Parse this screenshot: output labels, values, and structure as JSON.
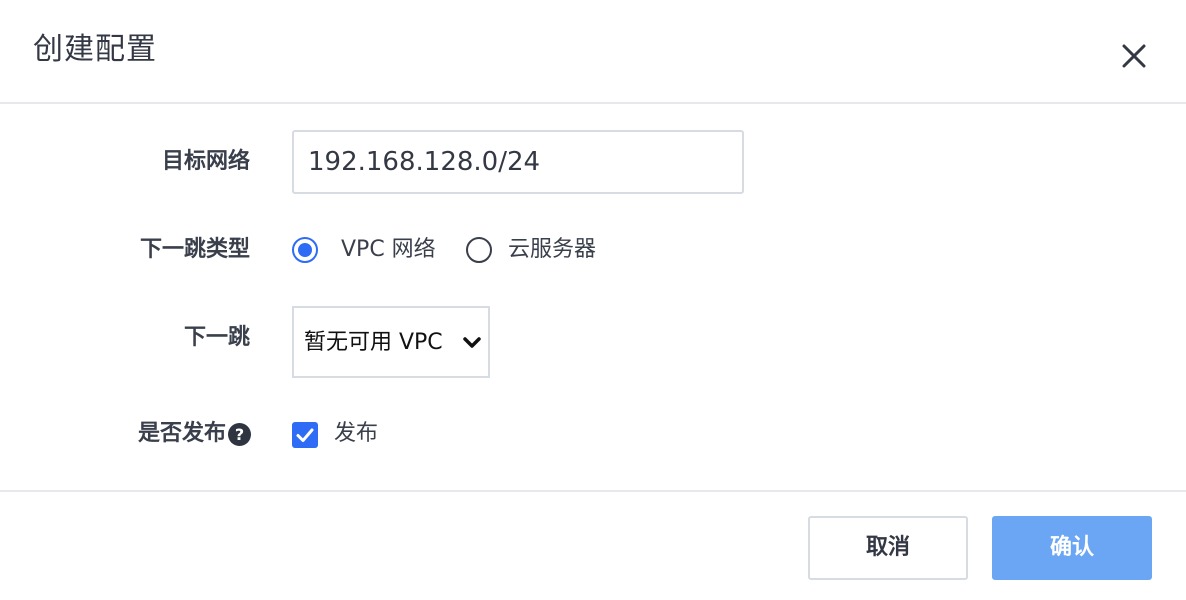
{
  "dialog": {
    "title": "创建配置",
    "close_icon": "close-icon"
  },
  "form": {
    "target_network": {
      "label": "目标网络",
      "value": "192.168.128.0/24"
    },
    "next_hop_type": {
      "label": "下一跳类型",
      "options": [
        {
          "label": "VPC 网络",
          "checked": true
        },
        {
          "label": "云服务器",
          "checked": false
        }
      ],
      "accent_color": "#2e6cf6"
    },
    "next_hop": {
      "label": "下一跳",
      "selected": "暂无可用 VPC",
      "icon": "chevron-down-icon"
    },
    "publish": {
      "label": "是否发布",
      "help_icon": "question-circle-icon",
      "help_glyph": "?",
      "checkbox_label": "发布",
      "checked": true
    }
  },
  "footer": {
    "cancel_label": "取消",
    "confirm_label": "确认",
    "confirm_color": "#6aa6f3"
  }
}
